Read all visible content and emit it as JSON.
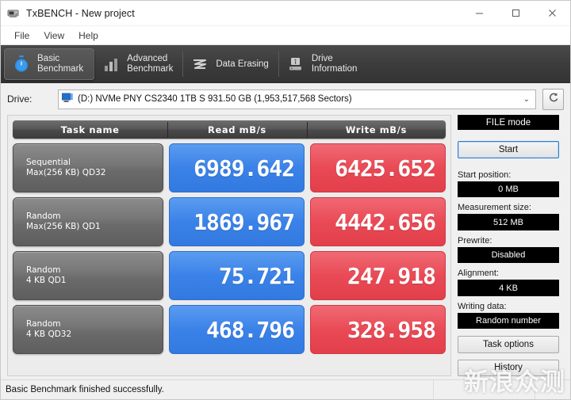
{
  "window": {
    "title": "TxBENCH - New project",
    "icon": "drive-icon",
    "minimize": "–",
    "maximize": "□",
    "close": "✕"
  },
  "menu": {
    "items": [
      {
        "label": "File"
      },
      {
        "label": "View"
      },
      {
        "label": "Help"
      }
    ]
  },
  "tabs": [
    {
      "label": "Basic\nBenchmark",
      "icon": "stopwatch-icon",
      "active": true
    },
    {
      "label": "Advanced\nBenchmark",
      "icon": "bar-chart-icon",
      "active": false
    },
    {
      "label": "Data Erasing",
      "icon": "shred-icon",
      "active": false
    },
    {
      "label": "Drive\nInformation",
      "icon": "drive-info-icon",
      "active": false
    }
  ],
  "drive": {
    "label": "Drive:",
    "icon": "drive-small-icon",
    "value": "(D:) NVMe PNY CS2340  1TB S  931.50 GB (1,953,517,568 Sectors)",
    "caret": "⌄",
    "refresh_icon": "refresh-icon"
  },
  "results": {
    "columns": [
      "Task name",
      "Read mB/s",
      "Write mB/s"
    ],
    "rows": [
      {
        "task": "Sequential\nMax(256 KB) QD32",
        "read": "6989.642",
        "write": "6425.652"
      },
      {
        "task": "Random\nMax(256 KB) QD1",
        "read": "1869.967",
        "write": "4442.656"
      },
      {
        "task": "Random\n4 KB QD1",
        "read": "75.721",
        "write": "247.918"
      },
      {
        "task": "Random\n4 KB QD32",
        "read": "468.796",
        "write": "328.958"
      }
    ]
  },
  "sidebar": {
    "mode": "FILE mode",
    "start": "Start",
    "start_position_label": "Start position:",
    "start_position_value": "0 MB",
    "measurement_size_label": "Measurement size:",
    "measurement_size_value": "512 MB",
    "prewrite_label": "Prewrite:",
    "prewrite_value": "Disabled",
    "alignment_label": "Alignment:",
    "alignment_value": "4 KB",
    "writing_data_label": "Writing data:",
    "writing_data_value": "Random number",
    "task_options": "Task options",
    "history": "History"
  },
  "status": {
    "message": "Basic Benchmark finished successfully.",
    "cell2": "",
    "cell3": ""
  },
  "watermark": "新浪众测",
  "colors": {
    "read": "#3b82e8",
    "write": "#e94a55",
    "tabstrip": "#3b3b3b",
    "accent": "#2f7fd0"
  }
}
